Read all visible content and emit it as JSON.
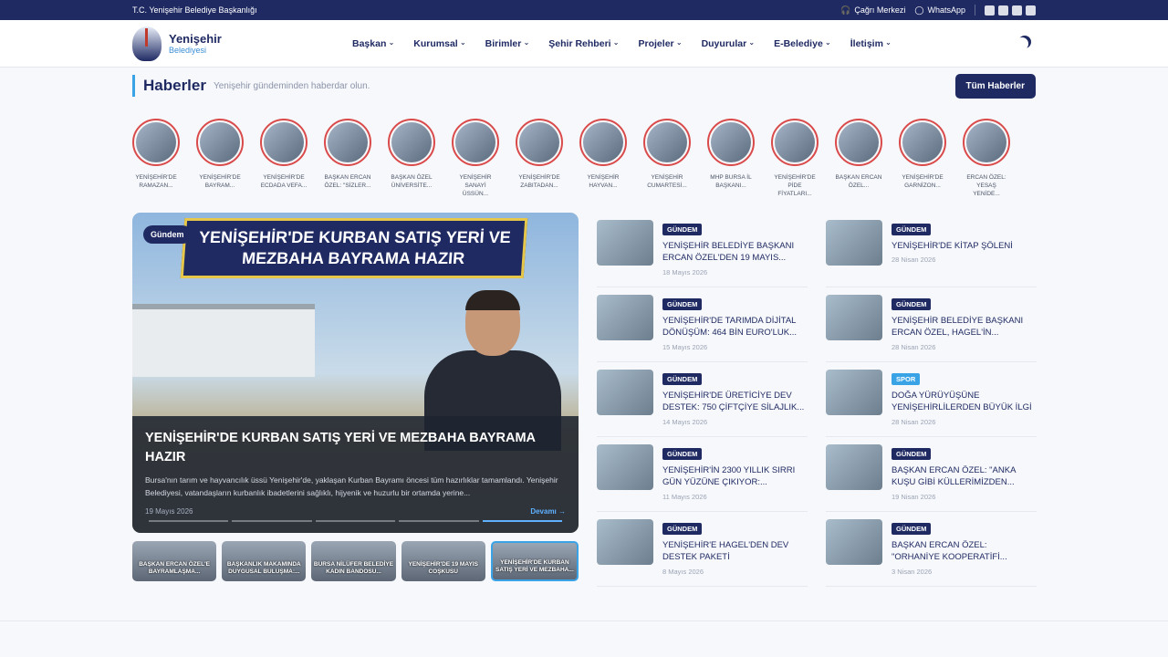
{
  "topbar": {
    "org": "T.C. Yenişehir Belediye Başkanlığı",
    "call": "Çağrı Merkezi",
    "whatsapp": "WhatsApp"
  },
  "brand": {
    "name": "Yenişehir",
    "sub": "Belediyesi"
  },
  "menu": [
    "Başkan",
    "Kurumsal",
    "Birimler",
    "Şehir Rehberi",
    "Projeler",
    "Duyurular",
    "E-Belediye",
    "İletişim"
  ],
  "section": {
    "title": "Haberler",
    "subtitle": "Yenişehir gündeminden haberdar olun.",
    "all_button": "Tüm Haberler"
  },
  "stories": [
    [
      "YENİŞEHİR'DE",
      "RAMAZAN..."
    ],
    [
      "YENİŞEHİR'DE",
      "BAYRAM..."
    ],
    [
      "YENİŞEHİR'DE",
      "ECDADA VEFA..."
    ],
    [
      "BAŞKAN ERCAN",
      "ÖZEL: \"SİZLER..."
    ],
    [
      "BAŞKAN ÖZEL",
      "ÜNİVERSİTE..."
    ],
    [
      "YENİŞEHİR",
      "SANAYİ ÜSSÜN..."
    ],
    [
      "YENİŞEHİR'DE",
      "ZABITADAN..."
    ],
    [
      "YENİŞEHİR",
      "HAYVAN..."
    ],
    [
      "YENİŞEHİR",
      "CUMARTESİ..."
    ],
    [
      "MHP BURSA İL",
      "BAŞKANI..."
    ],
    [
      "YENİŞEHİR'DE",
      "PİDE FİYATLARI..."
    ],
    [
      "BAŞKAN ERCAN",
      "ÖZEL..."
    ],
    [
      "YENİŞEHİR'DE",
      "GARNİZON..."
    ],
    [
      "ERCAN ÖZEL:",
      "YESAŞ YENİDE..."
    ]
  ],
  "hero": {
    "category": "Gündem",
    "banner_l1": "YENİŞEHİR'DE KURBAN SATIŞ YERİ VE",
    "banner_l2": "MEZBAHA BAYRAMA HAZIR",
    "title": "YENİŞEHİR'DE KURBAN SATIŞ YERİ VE MEZBAHA BAYRAMA HAZIR",
    "excerpt": "Bursa'nın tarım ve hayvancılık üssü Yenişehir'de, yaklaşan Kurban Bayramı öncesi tüm hazırlıklar tamamlandı. Yenişehir Belediyesi, vatandaşların kurbanlık ibadetlerini sağlıklı, hijyenik ve huzurlu bir ortamda yerine...",
    "date": "19 Mayıs 2026",
    "more": "Devamı →"
  },
  "thumbs": [
    "BAŞKAN ERCAN ÖZEL'E BAYRAMLAŞMA...",
    "BAŞKANLIK MAKAMINDA DUYGUSAL BULUŞMA:...",
    "BURSA NİLÜFER BELEDİYE KADIN BANDOSU...",
    "YENİŞEHİR'DE 19 MAYIS COŞKUSU",
    "YENİŞEHİR'DE KURBAN SATIŞ YERİ VE MEZBAHA..."
  ],
  "news_left": [
    {
      "cat": "GÜNDEM",
      "title": "YENİŞEHİR BELEDİYE BAŞKANI ERCAN ÖZEL'DEN 19 MAYIS...",
      "date": "18 Mayıs 2026"
    },
    {
      "cat": "GÜNDEM",
      "title": "YENİŞEHİR'DE TARIMDA DİJİTAL DÖNÜŞÜM: 464 BİN EURO'LUK...",
      "date": "15 Mayıs 2026"
    },
    {
      "cat": "GÜNDEM",
      "title": "YENİŞEHİR'DE ÜRETİCİYE DEV DESTEK: 750 ÇİFTÇİYE SİLAJLIK...",
      "date": "14 Mayıs 2026"
    },
    {
      "cat": "GÜNDEM",
      "title": "YENİŞEHİR'İN 2300 YILLIK SIRRI GÜN YÜZÜNE ÇIKIYOR:...",
      "date": "11 Mayıs 2026"
    },
    {
      "cat": "GÜNDEM",
      "title": "YENİŞEHİR'E HAGEL'DEN DEV DESTEK PAKETİ",
      "date": "8 Mayıs 2026"
    }
  ],
  "news_right": [
    {
      "cat": "GÜNDEM",
      "title": "YENİŞEHİR'DE KİTAP ŞÖLENİ",
      "date": "28 Nisan 2026"
    },
    {
      "cat": "GÜNDEM",
      "title": "YENİŞEHİR BELEDİYE BAŞKANI ERCAN ÖZEL, HAGEL'İN...",
      "date": "28 Nisan 2026"
    },
    {
      "cat": "SPOR",
      "title": "DOĞA YÜRÜYÜŞÜNE YENİŞEHİRLİLERDEN BÜYÜK İLGİ",
      "date": "28 Nisan 2026"
    },
    {
      "cat": "GÜNDEM",
      "title": "BAŞKAN ERCAN ÖZEL: \"ANKA KUŞU GİBİ KÜLLERİMİZDEN...",
      "date": "19 Nisan 2026"
    },
    {
      "cat": "GÜNDEM",
      "title": "BAŞKAN ERCAN ÖZEL: \"ORHANİYE KOOPERATİFİ...",
      "date": "3 Nisan 2026"
    }
  ]
}
